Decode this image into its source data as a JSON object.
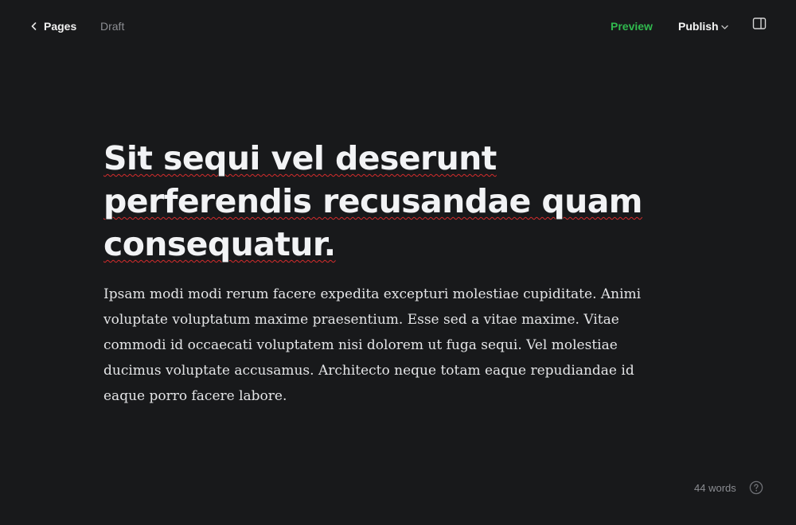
{
  "header": {
    "back_label": "Pages",
    "status": "Draft",
    "preview_label": "Preview",
    "publish_label": "Publish"
  },
  "post": {
    "title": "Sit sequi vel deserunt perferendis recusandae quam consequatur.",
    "body": "Ipsam modi modi rerum facere expedita excepturi molestiae cupiditate. Animi voluptate voluptatum maxime praesentium. Esse sed a vitae maxime. Vitae commodi id occaecati voluptatem nisi dolorem ut fuga sequi. Vel molestiae ducimus voluptate accusamus. Architecto neque totam eaque repudiandae id eaque porro facere labore."
  },
  "footer": {
    "word_count": "44 words"
  },
  "icons": {
    "back": "chevron-left-icon",
    "publish_menu": "chevron-down-icon",
    "sidebar": "sidebar-panel-icon",
    "help": "question-circle-icon"
  },
  "colors": {
    "background": "#18191b",
    "accent": "#30b94e",
    "muted_text": "#8b8d92",
    "spellcheck": "#d62c2c"
  }
}
